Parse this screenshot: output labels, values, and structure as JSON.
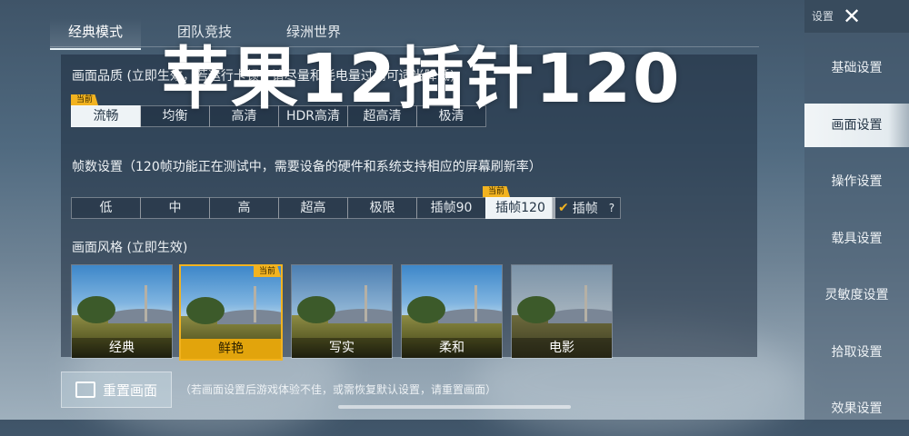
{
  "overlay_text": "苹果12插针120",
  "tabs": [
    "经典模式",
    "团队竞技",
    "绿洲世界"
  ],
  "current_tag": "当前",
  "quality": {
    "title": "画面品质 (立即生效，若运行卡顿，请尽量和耗电量过高可适当降低)",
    "options": [
      "流畅",
      "均衡",
      "高清",
      "HDR高清",
      "超高清",
      "极清"
    ],
    "selected": "流畅"
  },
  "fps": {
    "title": "帧数设置（120帧功能正在测试中，需要设备的硬件和系统支持相应的屏幕刷新率）",
    "options": [
      "低",
      "中",
      "高",
      "超高",
      "极限",
      "插帧90",
      "插帧120"
    ],
    "selected": "插帧120",
    "toggle_label": "插帧",
    "toggle_checked": true,
    "help": "?"
  },
  "style": {
    "title": "画面风格 (立即生效)",
    "options": [
      "经典",
      "鲜艳",
      "写实",
      "柔和",
      "电影"
    ],
    "selected": "鲜艳"
  },
  "sidebar": {
    "title": "设置",
    "items": [
      "基础设置",
      "画面设置",
      "操作设置",
      "载具设置",
      "灵敏度设置",
      "拾取设置",
      "效果设置"
    ],
    "selected": "画面设置"
  },
  "bottom": {
    "reset_label": "重置画面",
    "note": "（若画面设置后游戏体验不佳，或需恢复默认设置，请重置画面）"
  },
  "colors": {
    "accent": "#f2b320",
    "selected_bg": "#eef3f6"
  }
}
